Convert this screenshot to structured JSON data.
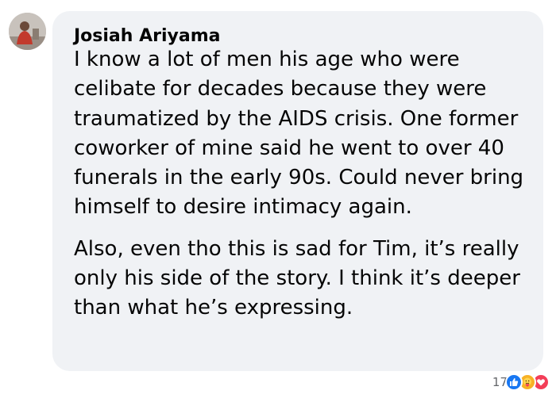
{
  "comment": {
    "author": "Josiah Ariyama",
    "paragraphs": [
      "I know a lot of men his age who were celibate for decades because they were traumatized by the AIDS crisis. One former coworker of mine said he went to over 40 funerals in the early 90s. Could never bring himself to desire intimacy again.",
      "Also, even tho this is sad for Tim, it’s really only his side of the story. I think it’s deeper than what he’s expressing."
    ]
  },
  "reactions": {
    "count": "17",
    "icons": [
      "like-icon",
      "care-icon",
      "love-icon"
    ]
  },
  "colors": {
    "bubble": "#f0f2f5",
    "like": "#1877f2",
    "care": "#f7b125",
    "love": "#f33e58"
  }
}
